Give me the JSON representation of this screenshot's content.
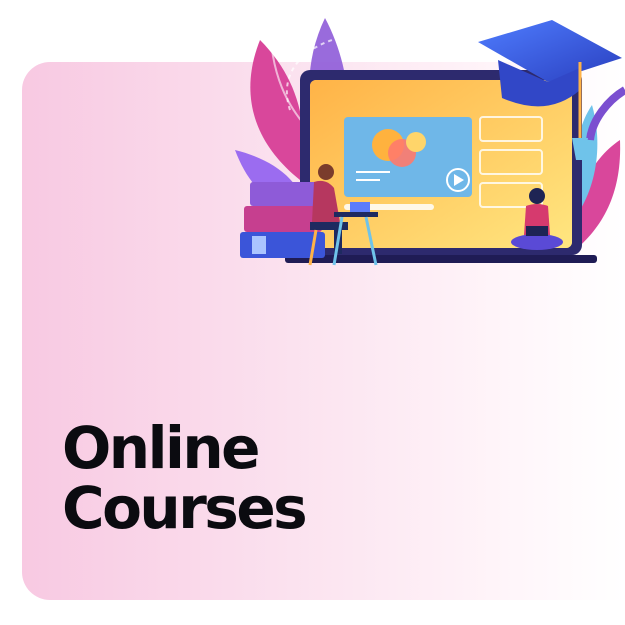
{
  "headline": {
    "line1": "Online",
    "line2": "Courses"
  },
  "colors": {
    "card_left": "#f8c9e2",
    "card_right": "#ffffff",
    "text": "#0b0b10",
    "screen_orange": "#ffd35a",
    "cap_blue": "#3b5fe0",
    "leaf_purple": "#8e5bd8",
    "leaf_pink": "#d9479b"
  },
  "illustration": {
    "icons": [
      "graduation-cap-icon",
      "laptop-icon",
      "play-icon",
      "book-stack-icon",
      "student-icon"
    ]
  }
}
